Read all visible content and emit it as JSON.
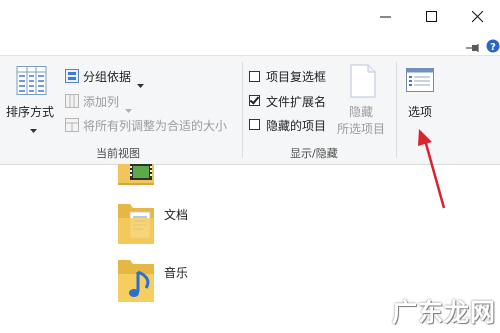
{
  "window": {
    "buttons": {
      "minimize": "minimize",
      "maximize": "maximize",
      "close": "close"
    }
  },
  "ribbon": {
    "sort": {
      "label": "排序方式"
    },
    "group_by": {
      "label": "分组依据"
    },
    "add_column": {
      "label": "添加列"
    },
    "fit_columns": {
      "label": "将所有列调整为合适的大小"
    },
    "current_view_label": "当前视图",
    "checkboxes": [
      {
        "label": "项目复选框",
        "checked": false
      },
      {
        "label": "文件扩展名",
        "checked": true
      },
      {
        "label": "隐藏的项目",
        "checked": false
      }
    ],
    "hide_selected": {
      "line1": "隐藏",
      "line2": "所选项目"
    },
    "show_hide_label": "显示/隐藏",
    "options": {
      "label": "选项"
    }
  },
  "files": [
    {
      "name": "",
      "icon": "video-folder-icon"
    },
    {
      "name": "文档",
      "icon": "documents-folder-icon"
    },
    {
      "name": "音乐",
      "icon": "music-folder-icon"
    }
  ],
  "annotation": {
    "color": "#d9232d"
  },
  "watermark": {
    "text": "广东龙网"
  }
}
